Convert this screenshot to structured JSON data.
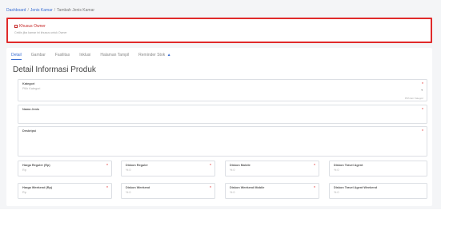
{
  "breadcrumb": {
    "items": [
      "Dashboard",
      "Jenis Kamar",
      "Tambah Jenis Kamar"
    ],
    "separator": "/"
  },
  "alert": {
    "title": "Khusus Owner",
    "subtitle": "Ceklis jika kamar ini khusus untuk Owner"
  },
  "tabs": [
    {
      "label": "Detail",
      "active": true
    },
    {
      "label": "Gambar"
    },
    {
      "label": "Fasilitas"
    },
    {
      "label": "Inklusi"
    },
    {
      "label": "Halaman Tampil"
    },
    {
      "label": "Reminder Stok",
      "icon": "warning-icon"
    }
  ],
  "section_title": "Detail Informasi Produk",
  "fields": {
    "kategori": {
      "label": "Kategori",
      "placeholder": "Pilih Kategori",
      "hint": "Pilih lain Kategori",
      "required": "*"
    },
    "nama_jenis": {
      "label": "Nama Jenis",
      "required": "*"
    },
    "deskripsi": {
      "label": "Deskripsi",
      "required": "*"
    },
    "harga_reguler": {
      "label": "Harga Reguler (Rp)",
      "value": "Rp",
      "required": "*"
    },
    "diskon_reguler": {
      "label": "Diskon Reguler",
      "value": "% 0",
      "required": "*"
    },
    "diskon_mobile": {
      "label": "Diskon Mobile",
      "value": "% 0",
      "required": "*"
    },
    "diskon_travel_agent": {
      "label": "Diskon Travel Agent",
      "value": "% 0"
    },
    "harga_weekend": {
      "label": "Harga Weekend (Rp)",
      "value": "Rp",
      "required": "*"
    },
    "diskon_weekend": {
      "label": "Diskon Weekend",
      "value": "% 0",
      "required": "*"
    },
    "diskon_weekend_mobile": {
      "label": "Diskon Weekend Mobile",
      "value": "% 0",
      "required": "*"
    },
    "diskon_travel_agent_weekend": {
      "label": "Diskon Travel Agent Weekend",
      "value": "% 0"
    }
  },
  "colors": {
    "accent": "#3b6fd4",
    "alert_border": "#e02a2a",
    "required": "#e02a2a"
  }
}
